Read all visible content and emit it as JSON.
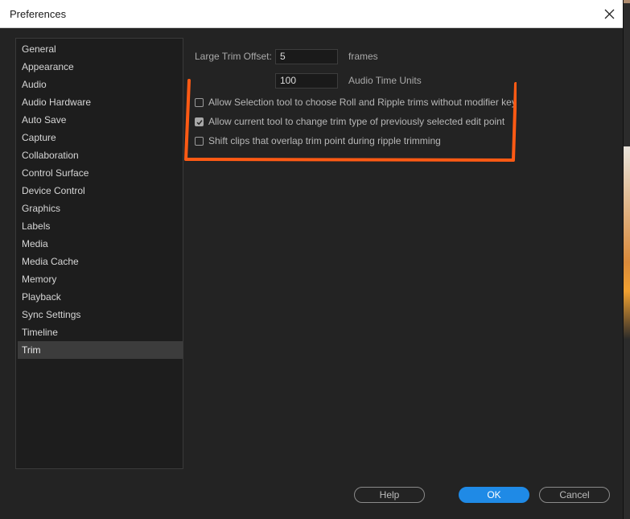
{
  "window": {
    "title": "Preferences"
  },
  "sidebar": {
    "items": [
      {
        "label": "General"
      },
      {
        "label": "Appearance"
      },
      {
        "label": "Audio"
      },
      {
        "label": "Audio Hardware"
      },
      {
        "label": "Auto Save"
      },
      {
        "label": "Capture"
      },
      {
        "label": "Collaboration"
      },
      {
        "label": "Control Surface"
      },
      {
        "label": "Device Control"
      },
      {
        "label": "Graphics"
      },
      {
        "label": "Labels"
      },
      {
        "label": "Media"
      },
      {
        "label": "Media Cache"
      },
      {
        "label": "Memory"
      },
      {
        "label": "Playback"
      },
      {
        "label": "Sync Settings"
      },
      {
        "label": "Timeline"
      },
      {
        "label": "Trim"
      }
    ],
    "selected": "Trim"
  },
  "trim": {
    "large_trim_offset_label": "Large Trim Offset:",
    "video_offset_value": "5",
    "video_unit": "frames",
    "audio_offset_value": "100",
    "audio_unit": "Audio Time Units",
    "options": [
      {
        "label": "Allow Selection tool to choose Roll and Ripple trims without modifier key",
        "checked": false
      },
      {
        "label": "Allow current tool to change trim type of previously selected edit point",
        "checked": true
      },
      {
        "label": "Shift clips that overlap trim point during ripple trimming",
        "checked": false
      }
    ]
  },
  "buttons": {
    "help": "Help",
    "ok": "OK",
    "cancel": "Cancel"
  },
  "colors": {
    "accent": "#1f8ae6",
    "annotation": "#ff5a14"
  }
}
